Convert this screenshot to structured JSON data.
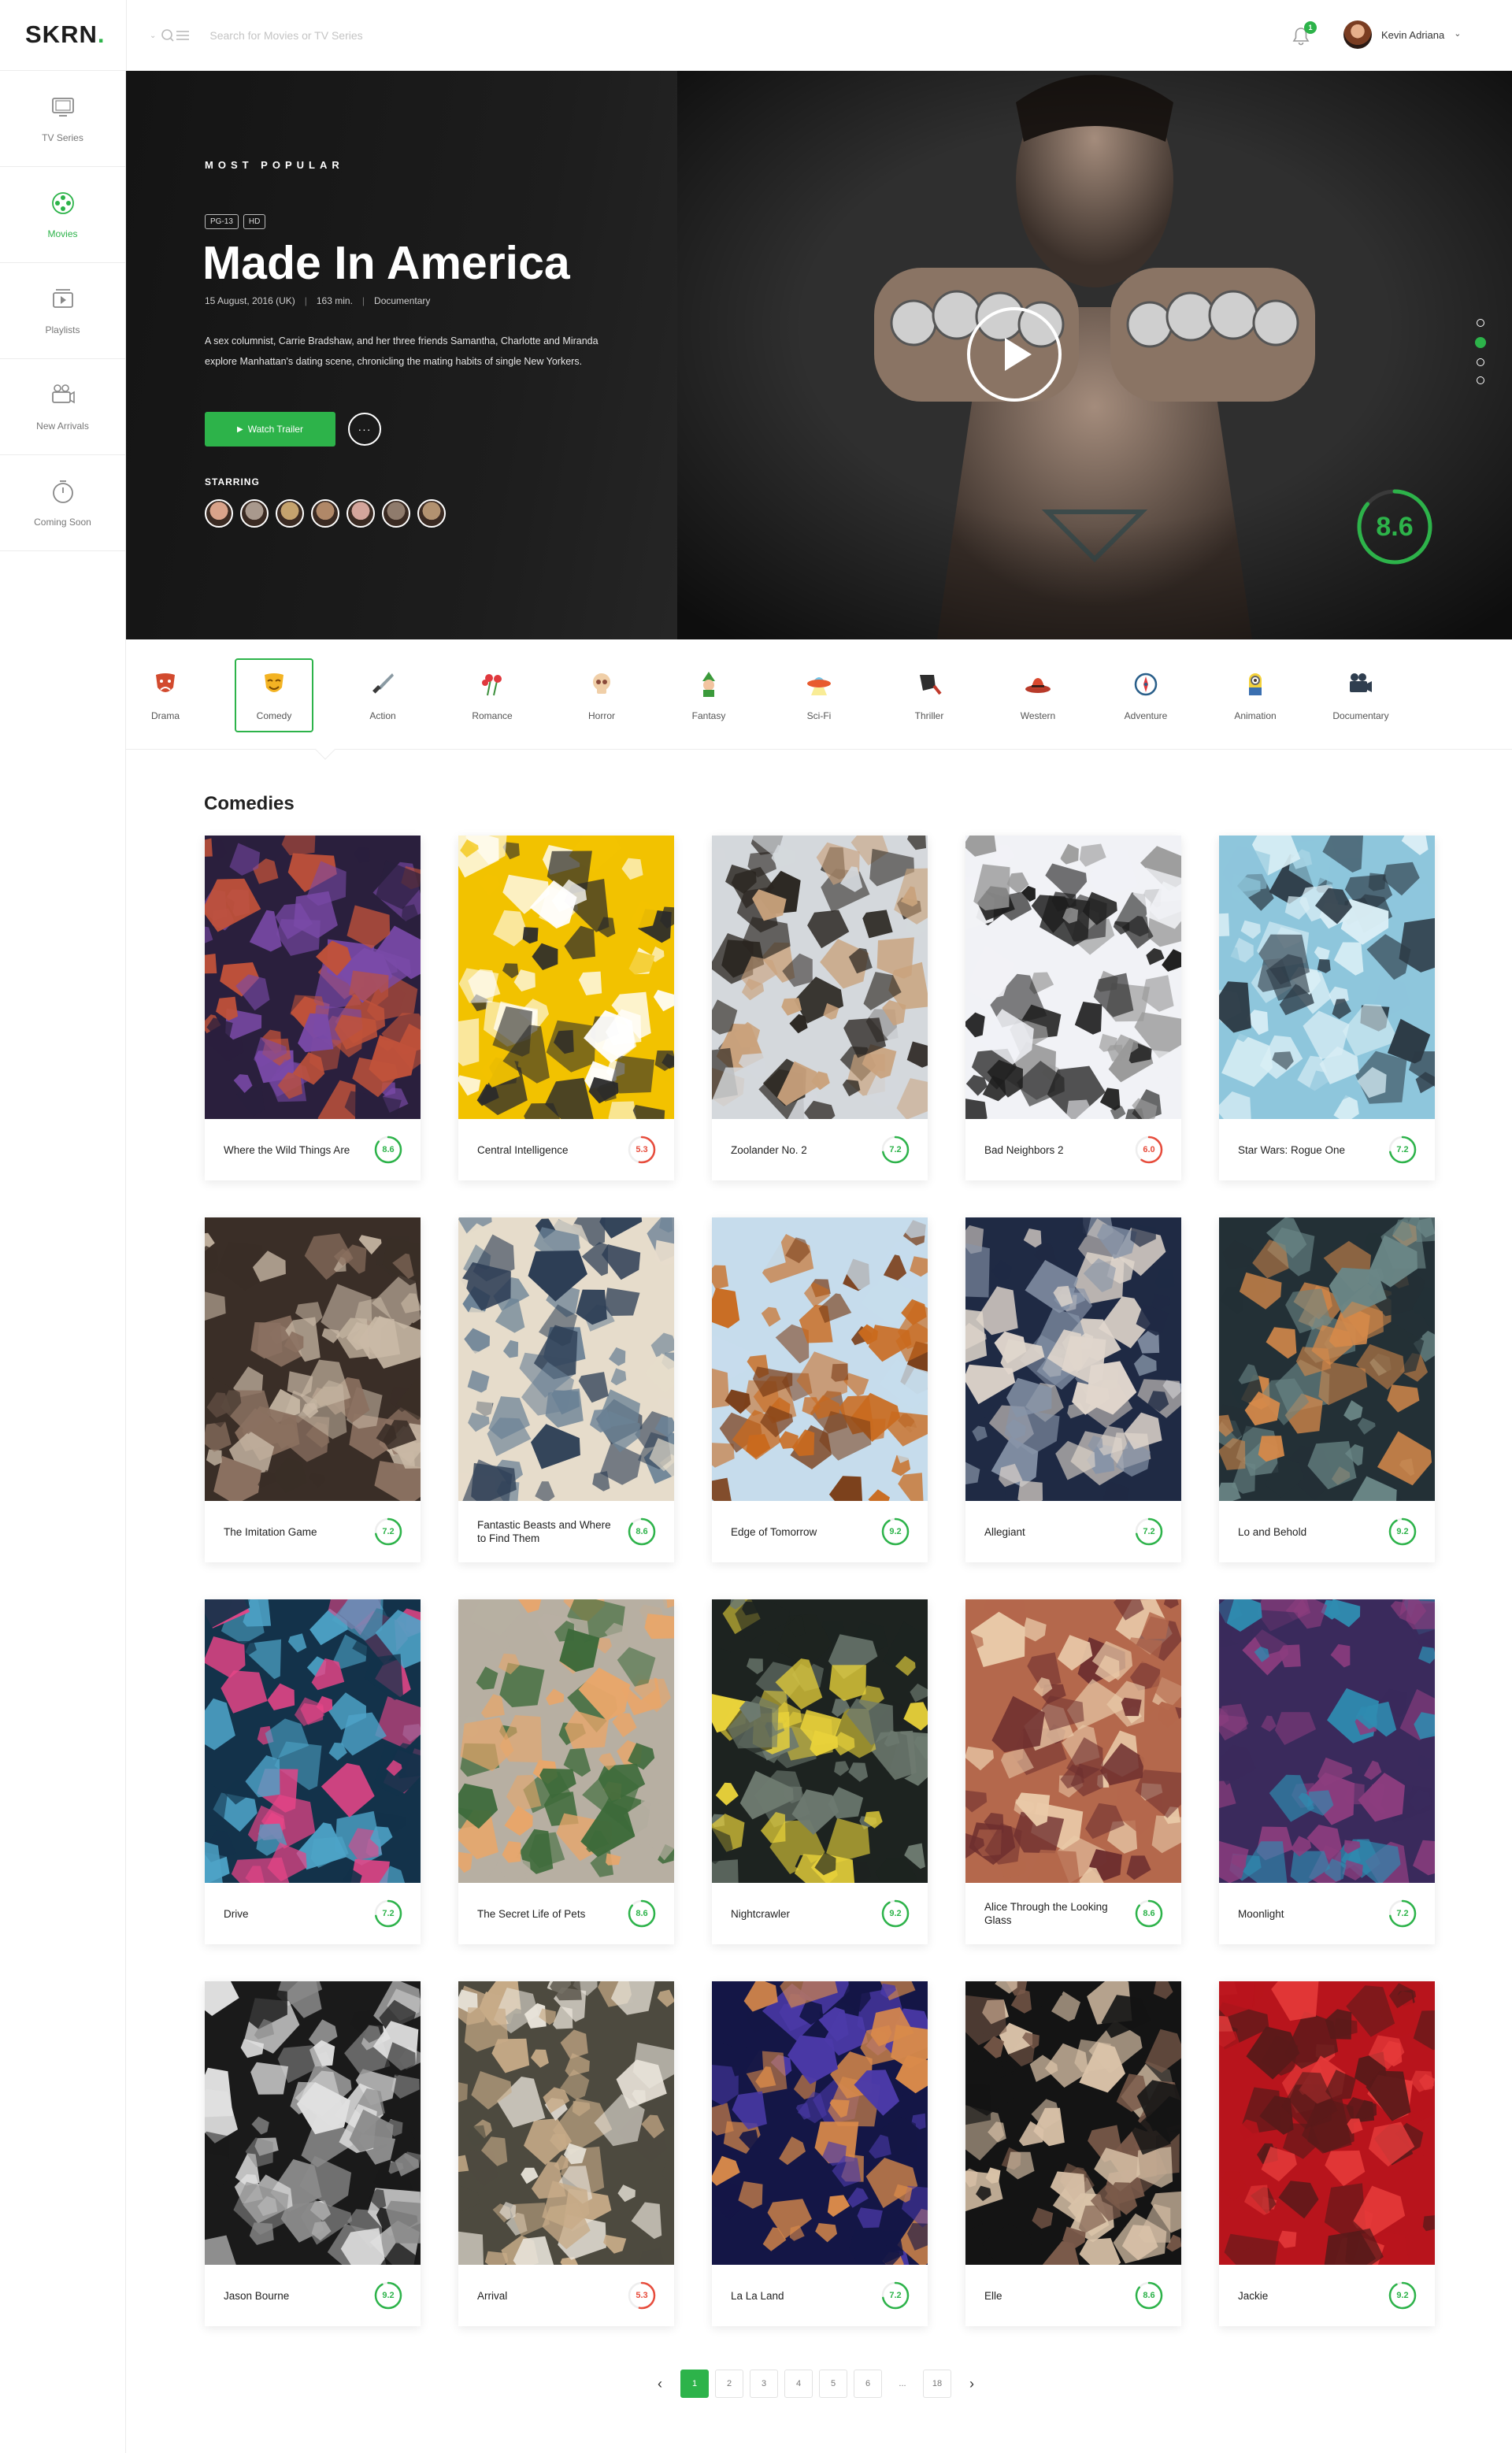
{
  "app": {
    "name": "SKRN",
    "logo_dot": "."
  },
  "search": {
    "placeholder": "Search for Movies or TV Series"
  },
  "notifications": {
    "count": "1"
  },
  "user": {
    "name": "Kevin Adriana"
  },
  "sidebar": {
    "items": [
      {
        "label": "TV Series",
        "icon": "tv-icon",
        "active": false
      },
      {
        "label": "Movies",
        "icon": "film-reel-icon",
        "active": true
      },
      {
        "label": "Playlists",
        "icon": "playlist-icon",
        "active": false
      },
      {
        "label": "New Arrivals",
        "icon": "projector-icon",
        "active": false
      },
      {
        "label": "Coming Soon",
        "icon": "stopwatch-icon",
        "active": false
      }
    ]
  },
  "hero": {
    "eyebrow": "MOST POPULAR",
    "badges": [
      "PG-13",
      "HD"
    ],
    "title": "Made In America",
    "date": "15 August, 2016 (UK)",
    "runtime": "163 min.",
    "genre": "Documentary",
    "description": "A sex columnist, Carrie Bradshaw, and her three friends Samantha, Charlotte and Miranda explore  Manhattan's dating scene, chronicling the mating habits of single New Yorkers.",
    "watch_label": "Watch Trailer",
    "more_label": "···",
    "starring_label": "STARRING",
    "rating": "8.6",
    "rating_fraction": 0.86,
    "cast_colors": [
      "#d9a38a",
      "#a9998d",
      "#c5a36e",
      "#b08868",
      "#d4a59b",
      "#8f7b6c",
      "#b29270"
    ],
    "slides": 4,
    "active_slide": 1
  },
  "genres": {
    "items": [
      {
        "label": "Drama",
        "icon": "drama-mask-icon"
      },
      {
        "label": "Comedy",
        "icon": "comedy-mask-icon"
      },
      {
        "label": "Action",
        "icon": "knife-icon"
      },
      {
        "label": "Romance",
        "icon": "roses-icon"
      },
      {
        "label": "Horror",
        "icon": "skull-icon"
      },
      {
        "label": "Fantasy",
        "icon": "elf-icon"
      },
      {
        "label": "Sci-Fi",
        "icon": "ufo-icon"
      },
      {
        "label": "Thriller",
        "icon": "cleaver-icon"
      },
      {
        "label": "Western",
        "icon": "cowboy-hat-icon"
      },
      {
        "label": "Adventure",
        "icon": "compass-icon"
      },
      {
        "label": "Animation",
        "icon": "minion-icon"
      },
      {
        "label": "Documentary",
        "icon": "camera-icon"
      }
    ],
    "active_index": 1
  },
  "section": {
    "title": "Comedies"
  },
  "colors": {
    "accent": "#2db34a",
    "low_rating": "#e74c3c"
  },
  "movies": [
    {
      "title": "Where the Wild Things Are",
      "rating": "8.6",
      "score": 0.86,
      "colors": [
        "#2a1f3d",
        "#c0523a",
        "#7a4aa8"
      ]
    },
    {
      "title": "Central Intelligence",
      "rating": "5.3",
      "score": 0.53,
      "colors": [
        "#f2c200",
        "#ffffff",
        "#2a2a2a"
      ]
    },
    {
      "title": "Zoolander No. 2",
      "rating": "7.2",
      "score": 0.72,
      "colors": [
        "#d4d8dc",
        "#2a2520",
        "#c9a27c"
      ]
    },
    {
      "title": "Bad Neighbors 2",
      "rating": "6.0",
      "score": 0.6,
      "colors": [
        "#f1f2f6",
        "#1e1e1e",
        "#9a9a9a"
      ]
    },
    {
      "title": "Star Wars: Rogue One",
      "rating": "7.2",
      "score": 0.72,
      "colors": [
        "#8ec6dc",
        "#2c3a45",
        "#d9eef5"
      ]
    },
    {
      "title": "The Imitation Game",
      "rating": "7.2",
      "score": 0.72,
      "colors": [
        "#3a2e27",
        "#c9b9a6",
        "#8a7060"
      ]
    },
    {
      "title": "Fantastic Beasts and Where to Find Them",
      "rating": "8.6",
      "score": 0.86,
      "colors": [
        "#e6dccb",
        "#6b8296",
        "#2d3e55"
      ]
    },
    {
      "title": "Edge of Tomorrow",
      "rating": "9.2",
      "score": 0.92,
      "colors": [
        "#c6dcec",
        "#c96a1e",
        "#7a3d17"
      ]
    },
    {
      "title": "Allegiant",
      "rating": "7.2",
      "score": 0.72,
      "colors": [
        "#1f2a44",
        "#8794a8",
        "#e0d6cc"
      ]
    },
    {
      "title": "Lo and Behold",
      "rating": "9.2",
      "score": 0.92,
      "colors": [
        "#233036",
        "#6a8686",
        "#d5894a"
      ]
    },
    {
      "title": "Drive",
      "rating": "7.2",
      "score": 0.72,
      "colors": [
        "#13324a",
        "#4da3c7",
        "#e64587"
      ]
    },
    {
      "title": "The Secret Life of Pets",
      "rating": "8.6",
      "score": 0.86,
      "colors": [
        "#b7afa2",
        "#3d6a3a",
        "#e8a66a"
      ]
    },
    {
      "title": "Nightcrawler",
      "rating": "9.2",
      "score": 0.92,
      "colors": [
        "#1d2320",
        "#6d7a70",
        "#e8d23a"
      ]
    },
    {
      "title": "Alice Through the Looking Glass",
      "rating": "8.6",
      "score": 0.86,
      "colors": [
        "#b4684c",
        "#e9c9a8",
        "#6e2f2f"
      ]
    },
    {
      "title": "Moonlight",
      "rating": "7.2",
      "score": 0.72,
      "colors": [
        "#3a2a5c",
        "#2f8bb0",
        "#8b3d7e"
      ]
    },
    {
      "title": "Jason Bourne",
      "rating": "9.2",
      "score": 0.92,
      "colors": [
        "#1a1a1a",
        "#8a8a8a",
        "#e0e0e0"
      ]
    },
    {
      "title": "Arrival",
      "rating": "5.3",
      "score": 0.53,
      "colors": [
        "#4d4a3f",
        "#c7ab88",
        "#e9e4da"
      ]
    },
    {
      "title": "La La Land",
      "rating": "7.2",
      "score": 0.72,
      "colors": [
        "#141646",
        "#4b3aa8",
        "#d98a4a"
      ]
    },
    {
      "title": "Elle",
      "rating": "8.6",
      "score": 0.86,
      "colors": [
        "#141414",
        "#7a5a4a",
        "#d9c2a8"
      ]
    },
    {
      "title": "Jackie",
      "rating": "9.2",
      "score": 0.92,
      "colors": [
        "#b8141c",
        "#e53a3a",
        "#5a1a1a"
      ]
    }
  ],
  "pagination": {
    "prev": "‹",
    "next": "›",
    "pages": [
      "1",
      "2",
      "3",
      "4",
      "5",
      "6",
      "...",
      "18"
    ],
    "active": "1"
  }
}
